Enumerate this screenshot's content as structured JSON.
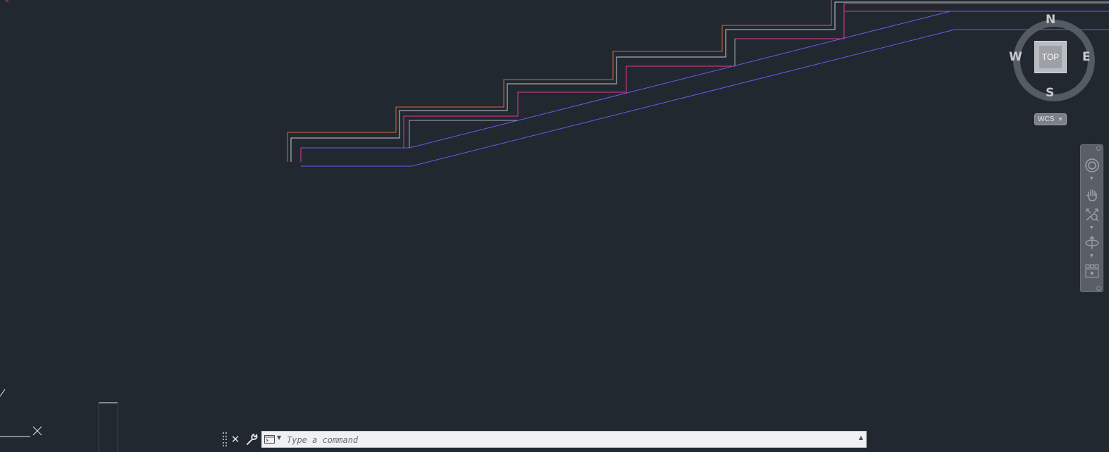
{
  "viewcube": {
    "face": "TOP",
    "north": "N",
    "south": "S",
    "east": "E",
    "west": "W"
  },
  "ucs_menu": {
    "label": "WCS"
  },
  "navbar": {
    "tools": [
      "steering-wheel-icon",
      "pan-hand-icon",
      "zoom-extents-icon",
      "orbit-icon",
      "showmotion-icon"
    ]
  },
  "command_line": {
    "placeholder": "Type a command",
    "value": ""
  },
  "colors": {
    "background": "#212830",
    "orange_line": "#d8683c",
    "white_line": "#c9ccd0",
    "magenta_line": "#e43a8e",
    "blue_line": "#6a5cf0"
  }
}
